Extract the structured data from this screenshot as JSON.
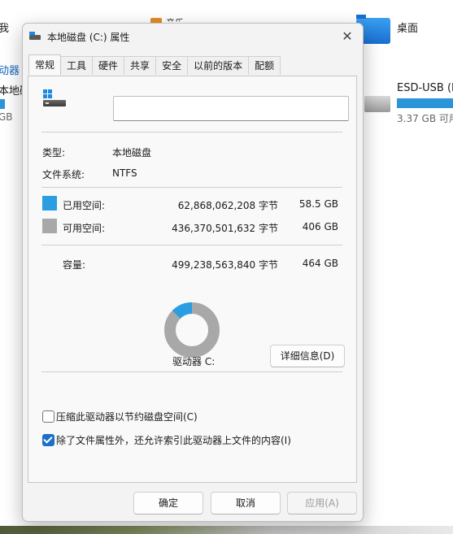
{
  "background": {
    "left_texts": [
      "我",
      "动器",
      "本地磁盘",
      "GB"
    ],
    "top_items": [
      "音乐"
    ],
    "desktop_label": "桌面",
    "usb_name": "ESD-USB (E:",
    "usb_free": "3.37 GB 可用"
  },
  "dialog": {
    "title": "本地磁盘 (C:) 属性",
    "close_glyph": "✕",
    "tabs": [
      "常规",
      "工具",
      "硬件",
      "共享",
      "安全",
      "以前的版本",
      "配额"
    ],
    "active_tab": "常规",
    "volume_name_value": "",
    "type_label": "类型:",
    "type_value": "本地磁盘",
    "fs_label": "文件系统:",
    "fs_value": "NTFS",
    "used": {
      "label": "已用空间:",
      "bytes": "62,868,062,208 字节",
      "size": "58.5 GB",
      "color": "#2a9ee0"
    },
    "free": {
      "label": "可用空间:",
      "bytes": "436,370,501,632 字节",
      "size": "406 GB",
      "color": "#a8a8a8"
    },
    "capacity": {
      "label": "容量:",
      "bytes": "499,238,563,840 字节",
      "size": "464 GB"
    },
    "used_fraction": 0.126,
    "drive_label": "驱动器 C:",
    "details_button": "详细信息(D)",
    "compress_label": "压缩此驱动器以节约磁盘空间(C)",
    "compress_checked": false,
    "index_label": "除了文件属性外，还允许索引此驱动器上文件的内容(I)",
    "index_checked": true,
    "ok_button": "确定",
    "cancel_button": "取消",
    "apply_button": "应用(A)"
  }
}
